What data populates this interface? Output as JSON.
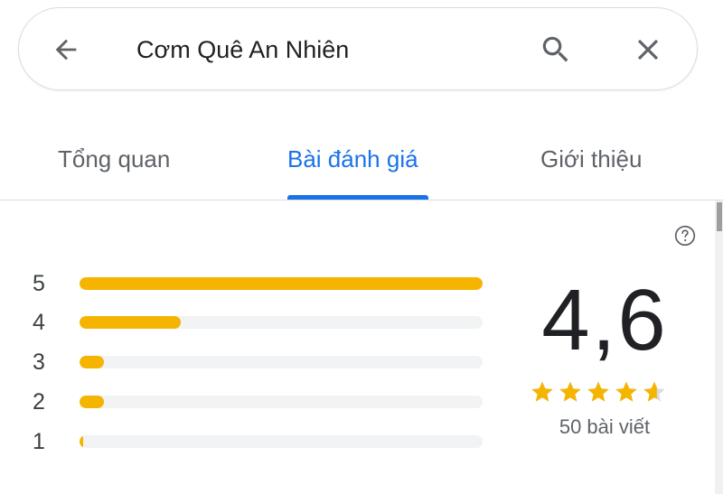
{
  "search": {
    "query": "Cơm Quê An Nhiên"
  },
  "icons": {
    "back": "arrow-back-icon",
    "search": "search-icon",
    "close": "close-icon",
    "help": "help-circle-icon",
    "star": "star-icon"
  },
  "tabs": [
    {
      "label": "Tổng quan",
      "active": false
    },
    {
      "label": "Bài đánh giá",
      "active": true
    },
    {
      "label": "Giới thiệu",
      "active": false
    }
  ],
  "rating": {
    "score": "4,6",
    "stars_value": 4.6,
    "review_count": "50 bài viết",
    "distribution": [
      {
        "label": "5",
        "fraction": 1.0
      },
      {
        "label": "4",
        "fraction": 0.25
      },
      {
        "label": "3",
        "fraction": 0.06
      },
      {
        "label": "2",
        "fraction": 0.06
      },
      {
        "label": "1",
        "fraction": 0.01
      }
    ]
  },
  "colors": {
    "accent": "#1a73e8",
    "star": "#f5b400",
    "track": "#f1f3f4",
    "text_primary": "#202124",
    "text_secondary": "#5f6368"
  }
}
